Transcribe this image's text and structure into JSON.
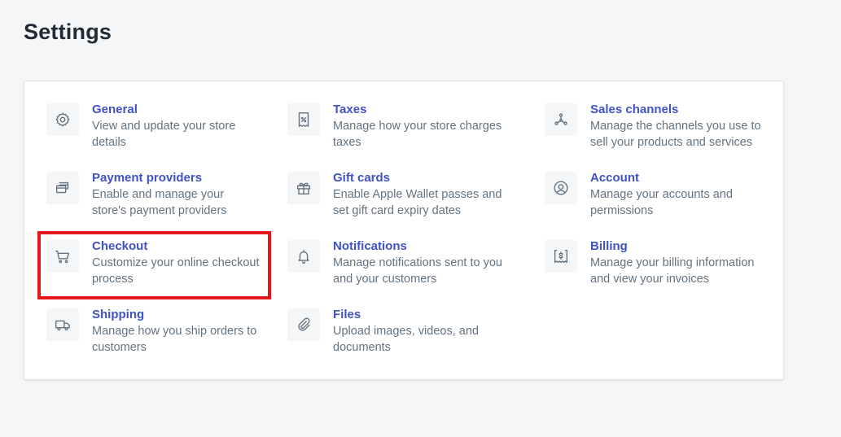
{
  "page": {
    "title": "Settings"
  },
  "settings": [
    {
      "key": "general",
      "icon": "gear-icon",
      "title": "General",
      "desc": [
        "View and update your store",
        "details"
      ]
    },
    {
      "key": "payment-providers",
      "icon": "payment-icon",
      "title": "Payment providers",
      "desc": [
        "Enable and manage your",
        "store's payment providers"
      ]
    },
    {
      "key": "checkout",
      "icon": "cart-icon",
      "title": "Checkout",
      "desc": [
        "Customize your online checkout",
        "process"
      ]
    },
    {
      "key": "shipping",
      "icon": "truck-icon",
      "title": "Shipping",
      "desc": [
        "Manage how you ship orders to",
        "customers"
      ]
    },
    {
      "key": "taxes",
      "icon": "tax-receipt-icon",
      "title": "Taxes",
      "desc": [
        "Manage how your store charges",
        "taxes"
      ]
    },
    {
      "key": "gift-cards",
      "icon": "gift-icon",
      "title": "Gift cards",
      "desc": [
        "Enable Apple Wallet passes and",
        "set gift card expiry dates"
      ]
    },
    {
      "key": "notifications",
      "icon": "bell-icon",
      "title": "Notifications",
      "desc": [
        "Manage notifications sent to you",
        "and your customers"
      ]
    },
    {
      "key": "files",
      "icon": "paperclip-icon",
      "title": "Files",
      "desc": [
        "Upload images, videos, and",
        "documents"
      ]
    },
    {
      "key": "sales-channels",
      "icon": "channels-icon",
      "title": "Sales channels",
      "desc": [
        "Manage the channels you use to",
        "sell your products and services"
      ]
    },
    {
      "key": "account",
      "icon": "user-circle-icon",
      "title": "Account",
      "desc": [
        "Manage your accounts and",
        "permissions"
      ]
    },
    {
      "key": "billing",
      "icon": "billing-icon",
      "title": "Billing",
      "desc": [
        "Manage your billing information",
        "and view your invoices"
      ]
    }
  ],
  "colors": {
    "link": "#3f52c9",
    "muted": "#637381",
    "highlight": "#e3191e",
    "background": "#f4f6f8"
  }
}
